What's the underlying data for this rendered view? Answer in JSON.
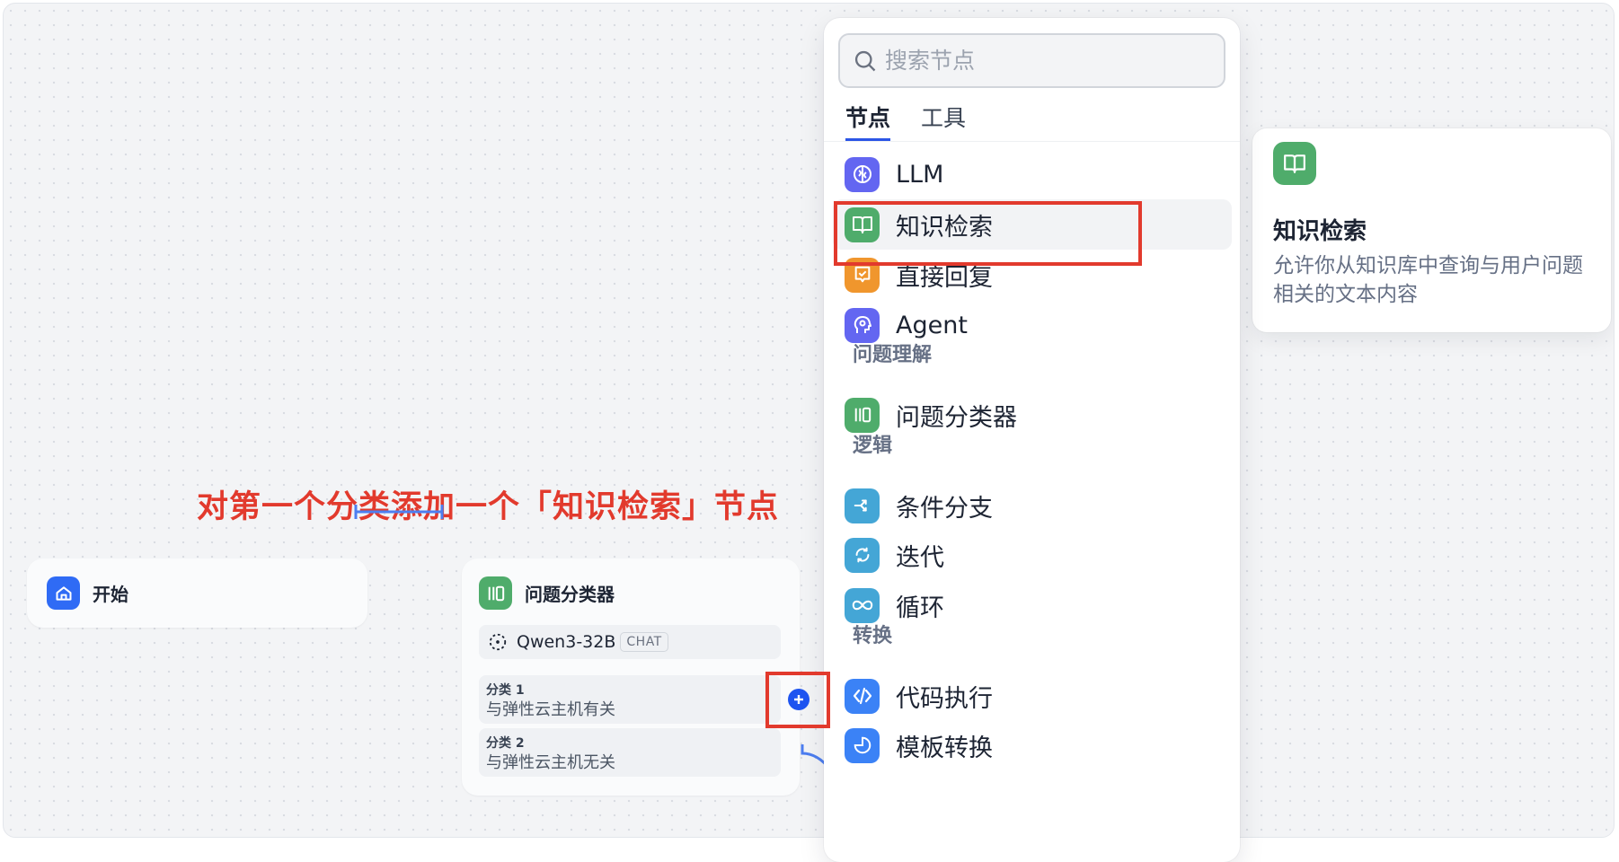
{
  "colors": {
    "accent": "#2b55e6",
    "annotation_red": "#e23a2d",
    "start_blue": "#2f6bf5",
    "green": "#4fac6b",
    "llm_purple": "#6366f1",
    "answer_orange": "#f0962d",
    "teal": "#44a6d6",
    "code_blue": "#3b82f6"
  },
  "annotation": "对第一个分类添加一个「知识检索」节点",
  "start_node": {
    "title": "开始",
    "icon": "home-icon"
  },
  "classifier_node": {
    "title": "问题分类器",
    "icon": "classifier-icon",
    "model": {
      "name": "Qwen3-32B",
      "badge": "CHAT",
      "icon": "model-icon"
    },
    "classes": [
      {
        "name": "分类 1",
        "desc": "与弹性云主机有关"
      },
      {
        "name": "分类 2",
        "desc": "与弹性云主机无关"
      }
    ],
    "add_icon": "plus-icon"
  },
  "picker": {
    "search_placeholder": "搜索节点",
    "search_icon": "search-icon",
    "tabs": [
      "节点",
      "工具"
    ],
    "active_tab": "节点",
    "items": [
      {
        "label": "LLM",
        "icon": "llm-icon"
      },
      {
        "label": "知识检索",
        "icon": "book-icon",
        "selected": true
      },
      {
        "label": "直接回复",
        "icon": "reply-icon"
      },
      {
        "label": "Agent",
        "icon": "agent-icon"
      }
    ],
    "section_understanding": "问题理解",
    "classifier_item": {
      "label": "问题分类器",
      "icon": "classifier-icon"
    },
    "section_logic": "逻辑",
    "logic_items": [
      {
        "label": "条件分支",
        "icon": "branch-icon"
      },
      {
        "label": "迭代",
        "icon": "iteration-icon"
      },
      {
        "label": "循环",
        "icon": "loop-icon"
      }
    ],
    "section_transform": "转换",
    "transform_items": [
      {
        "label": "代码执行",
        "icon": "code-icon"
      },
      {
        "label": "模板转换",
        "icon": "template-icon"
      }
    ]
  },
  "tooltip": {
    "title": "知识检索",
    "description": "允许你从知识库中查询与用户问题相关的文本内容",
    "icon": "book-icon"
  }
}
